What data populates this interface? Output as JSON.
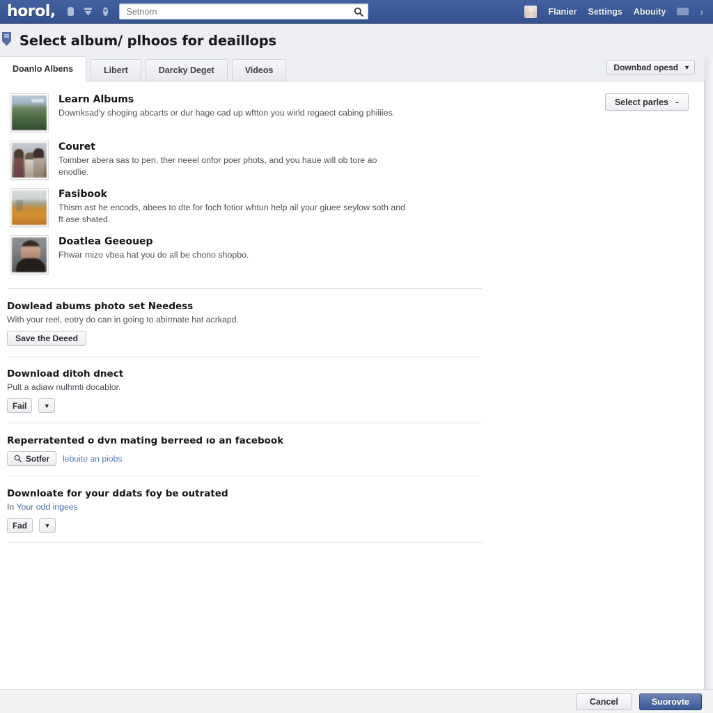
{
  "topbar": {
    "brand": "horol,",
    "icons": [
      "home-icon",
      "friends-icon",
      "notifications-icon"
    ],
    "search": {
      "placeholder": "Setnorn",
      "value": "",
      "icon": "search-icon"
    },
    "right_items": [
      {
        "name": "profile",
        "label": "Flanier",
        "icon": "avatar"
      },
      {
        "name": "settings",
        "label": "Settings"
      },
      {
        "name": "about",
        "label": "Abouity"
      }
    ],
    "badge": "",
    "chevron": "›",
    "colors": {
      "bar": "#3b5998",
      "bar_dark": "#36528d",
      "bar_light": "#43619e"
    }
  },
  "page": {
    "title": "Select album/ plhoos for deaillops",
    "shield_icon": "shield-icon"
  },
  "tabs": [
    {
      "label": "Doanlo Albens",
      "active": true
    },
    {
      "label": "Libert",
      "active": false
    },
    {
      "label": "Darcky Deget",
      "active": false
    },
    {
      "label": "Videos",
      "active": false
    }
  ],
  "toolbar": {
    "download_speed_label": "Downbad opesd",
    "download_speed_caret": "▼",
    "select_photos_label": "Select parles",
    "select_photos_caret": "–"
  },
  "albums": [
    {
      "title": "Learn Albums",
      "desc": "Downksad'y shoging abcarts or dur hage cad up wftton you wirld regaect cabing philiies.",
      "thumb": "t-landscape",
      "thumb_name": "album-thumbnail-landscape"
    },
    {
      "title": "Couret",
      "desc": "Toimber abera sas to pen, ther neeel onfor poer phots, and you haue will ob tore ao enodlie.",
      "thumb": "t-group",
      "thumb_name": "album-thumbnail-group-portrait"
    },
    {
      "title": "Fasibook",
      "desc": "Thism ast he encods, abees to dte for foch fotior whtun help ail your giuee seylow soth and ft ase shated.",
      "thumb": "t-autumn",
      "thumb_name": "album-thumbnail-autumn-field"
    },
    {
      "title": "Doatlea Geeouep",
      "desc": "Fhwar mizo vbea hat you do all be chono shopbo.",
      "thumb": "t-portrait",
      "thumb_name": "album-thumbnail-portrait"
    }
  ],
  "sections": [
    {
      "id": "needess",
      "title": "Dowlead abums photo set Needess",
      "desc": "With your reel, eotry do can in going to abirmate hat acrkapd.",
      "desc_link": "",
      "buttons": [
        {
          "name": "save-the-deed-button",
          "label": "Save the Deeed",
          "kind": "wide"
        }
      ]
    },
    {
      "id": "direct",
      "title": "Download ditoh dnect",
      "desc": "Pult a adiaw nulhmti docablor.",
      "desc_link": "",
      "buttons": [
        {
          "name": "file-button",
          "label": "Fail",
          "kind": "tiny"
        },
        {
          "name": "file-dropdown-button",
          "label": "▼",
          "kind": "caret"
        }
      ]
    },
    {
      "id": "facebook",
      "title": "Reperratented o dvn mating berreed ıo an facebook",
      "desc": "",
      "desc_link": "",
      "buttons": [
        {
          "name": "surfer-search-button",
          "label": "Sotfer",
          "kind": "search"
        },
        {
          "name": "delete-photos-link",
          "label": "lebuite an piobs",
          "kind": "link"
        }
      ]
    },
    {
      "id": "outrated",
      "title": "Downloate for your ddats foy be outrated",
      "desc_prefix": "In ",
      "desc_link": "Your odd ingees",
      "desc": "",
      "buttons": [
        {
          "name": "folder-button",
          "label": "Fad",
          "kind": "tiny"
        },
        {
          "name": "folder-dropdown-button",
          "label": "▼",
          "kind": "caret"
        }
      ]
    }
  ],
  "footer": {
    "cancel_label": "Cancel",
    "submit_label": "Suorovte"
  }
}
